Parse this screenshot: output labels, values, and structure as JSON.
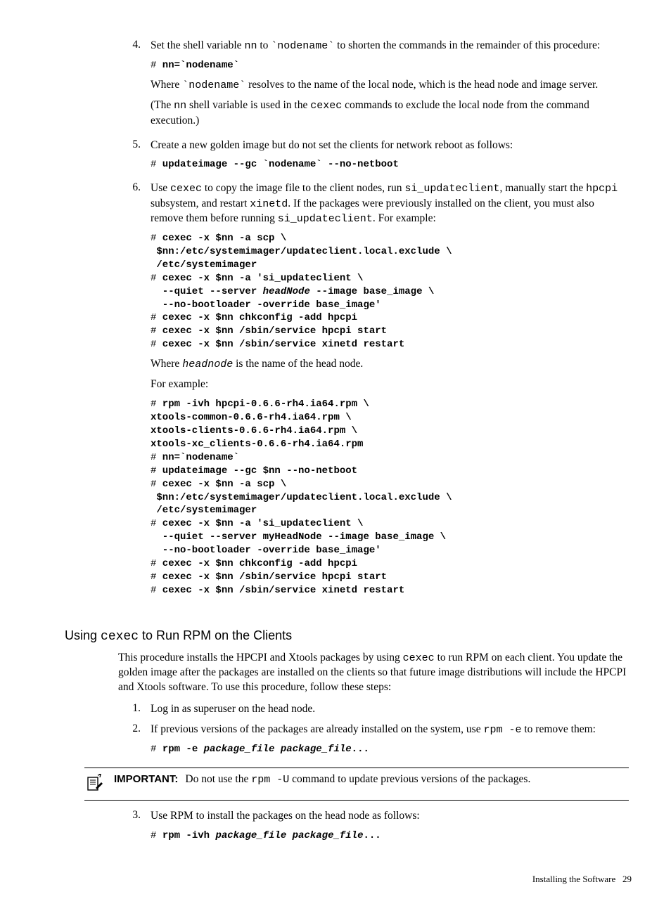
{
  "steps": {
    "s4": {
      "num": "4.",
      "p1a": "Set the shell variable ",
      "p1code1": "nn",
      "p1b": " to ",
      "p1code2": "`nodename`",
      "p1c": " to shorten the commands in the remainder of this procedure:",
      "code1": "# nn=`nodename`",
      "p2a": "Where ",
      "p2code1": "`nodename`",
      "p2b": " resolves to the name of the local node, which is the head node and image server.",
      "p3a": "(The ",
      "p3code1": "nn",
      "p3b": " shell variable is used in the ",
      "p3code2": "cexec",
      "p3c": " commands to exclude the local node from the command execution.)"
    },
    "s5": {
      "num": "5.",
      "p1": "Create a new golden image but do not set the clients for network reboot as follows:",
      "code1": "# updateimage --gc `nodename` --no-netboot"
    },
    "s6": {
      "num": "6.",
      "p1a": "Use ",
      "p1code1": "cexec",
      "p1b": " to copy the image file to the client nodes, run  ",
      "p1code2": "si_updateclient",
      "p1c": ", manually start the ",
      "p1code3": "hpcpi",
      "p1d": " subsystem, and restart ",
      "p1code4": "xinetd",
      "p1e": ". If the packages were previously installed on the client, you must also remove them before running ",
      "p1code5": "si_updateclient",
      "p1f": ". For example:",
      "code1": "# cexec -x $nn -a scp \\\n $nn:/etc/systemimager/updateclient.local.exclude \\\n /etc/systemimager\n# cexec -x $nn -a 'si_updateclient \\\n  --quiet --server headNode --image base_image \\\n  --no-bootloader -override base_image'\n# cexec -x $nn chkconfig -add hpcpi\n# cexec -x $nn /sbin/service hpcpi start\n# cexec -x $nn /sbin/service xinetd restart",
      "p2a": "Where ",
      "p2i": "headnode",
      "p2b": " is the name of the head node.",
      "p3": "For example:",
      "code2": "# rpm -ivh hpcpi-0.6.6-rh4.ia64.rpm \\\nxtools-common-0.6.6-rh4.ia64.rpm \\\nxtools-clients-0.6.6-rh4.ia64.rpm \\\nxtools-xc_clients-0.6.6-rh4.ia64.rpm\n# nn=`nodename`\n# updateimage --gc $nn --no-netboot\n# cexec -x $nn -a scp \\\n $nn:/etc/systemimager/updateclient.local.exclude \\\n /etc/systemimager\n# cexec -x $nn -a 'si_updateclient \\\n  --quiet --server myHeadNode --image base_image \\\n  --no-bootloader -override base_image'\n# cexec -x $nn chkconfig -add hpcpi\n# cexec -x $nn /sbin/service hpcpi start\n# cexec -x $nn /sbin/service xinetd restart"
    }
  },
  "section2": {
    "heading_a": "Using ",
    "heading_code": "cexec",
    "heading_b": " to Run RPM on the Clients",
    "intro_a": "This procedure installs the HPCPI and Xtools packages by using ",
    "intro_code": "cexec",
    "intro_b": " to run RPM on each client. You update the golden image after the packages are installed on the clients so that future image distributions will include the HPCPI and Xtools software. To use this procedure, follow these steps:",
    "s1": {
      "num": "1.",
      "p1": "Log in as superuser on the head node."
    },
    "s2": {
      "num": "2.",
      "p1a": "If previous versions of the packages are already installed on the system, use ",
      "p1code": "rpm -e",
      "p1b": " to remove them:",
      "code_prefix": "# ",
      "code_cmd": "rpm -e ",
      "code_args": "package_file package_file",
      "code_suffix": "..."
    },
    "important": {
      "label": "IMPORTANT:",
      "text_a": "Do not use the ",
      "text_code": "rpm -U",
      "text_b": " command to update previous versions of the packages."
    },
    "s3": {
      "num": "3.",
      "p1": "Use RPM to install the packages on the head node as follows:",
      "code_prefix": "# ",
      "code_cmd": "rpm -ivh ",
      "code_args": "package_file package_file",
      "code_suffix": "..."
    }
  },
  "footer": {
    "label": "Installing the Software",
    "page": "29"
  }
}
